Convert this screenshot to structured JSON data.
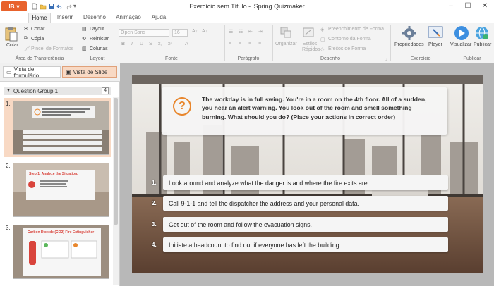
{
  "app": {
    "button_label": "IB",
    "title": "Exercício sem Título - iSpring Quizmaker"
  },
  "tabs": [
    "Home",
    "Inserir",
    "Desenho",
    "Animação",
    "Ajuda"
  ],
  "ribbon": {
    "groups": {
      "clipboard": "Área de Transferência",
      "layout": "Layout",
      "font": "Fonte",
      "paragraph": "Parágrafo",
      "drawing": "Desenho",
      "exercise": "Exercício",
      "publish": "Publicar"
    },
    "paste": "Colar",
    "cut": "Cortar",
    "copy": "Cópia",
    "format_painter": "Pincel de Formatos",
    "layout": "Layout",
    "reset": "Reiniciar",
    "columns": "Colunas",
    "font_name": "Open Sans",
    "font_size": "16",
    "organize": "Organizar",
    "quick_styles": "Estilos Rápidos",
    "shape_fill": "Preenchimento de Forma",
    "shape_outline": "Contorno da Forma",
    "shape_effects": "Efeitos de Forma",
    "properties": "Propriedades",
    "player": "Player",
    "preview": "Visualizar",
    "publish": "Publicar"
  },
  "left_pane": {
    "form_view": "Vista de formulário",
    "slide_view": "Vista de Slide",
    "group_name": "Question Group 1",
    "group_count": "4",
    "slides": [
      {
        "num": "1.",
        "title": ""
      },
      {
        "num": "2.",
        "title": "Step 1. Analyze the Situation."
      },
      {
        "num": "3.",
        "title": "Carbon Dioxide (CO2) Fire Extinguisher"
      }
    ]
  },
  "slide": {
    "question_icon": "?",
    "question": "The workday is in full swing. You're in a room on the 4th floor. All of a sudden, you hear an alert warning. You look out of the room and smell something burning. What should you do? (Place your actions in correct order)",
    "answers": [
      {
        "num": "1.",
        "text": "Look around and analyze what the danger is and where the fire exits are."
      },
      {
        "num": "2.",
        "text": "Call 9-1-1 and tell the dispatcher the address and your personal data."
      },
      {
        "num": "3.",
        "text": "Get out of the room and follow the evacuation signs."
      },
      {
        "num": "4.",
        "text": "Initiate a headcount to find out if everyone has left the building."
      }
    ]
  },
  "colors": {
    "accent": "#e8622c",
    "selection": "#f8d9c4"
  }
}
